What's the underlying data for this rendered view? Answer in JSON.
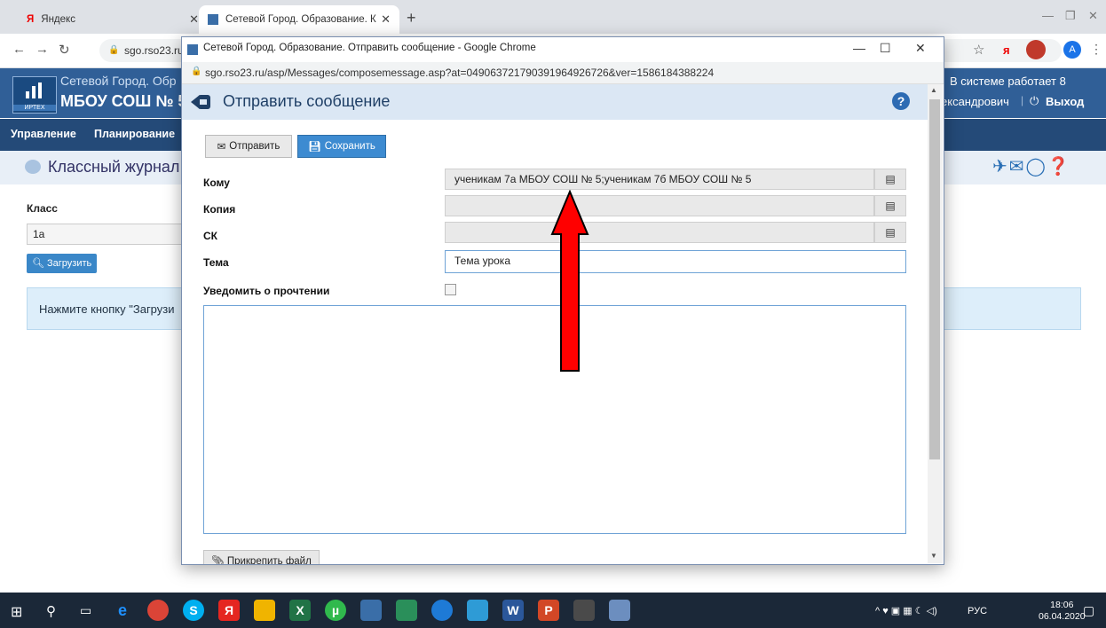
{
  "browser": {
    "tabs": [
      {
        "label": "Яндекс"
      },
      {
        "label": "Сетевой Город. Образование. К"
      }
    ],
    "url": "sgo.rso23.ru"
  },
  "site": {
    "name_line1": "Сетевой Город. Обр",
    "name_line2": "МБОУ СОШ № 5",
    "system_info": "В системе работает 8",
    "user_name": "ександрович",
    "exit_label": "Выход",
    "brand": "ИРТЕХ"
  },
  "menu": {
    "items": [
      "Управление",
      "Планирование"
    ]
  },
  "journal": {
    "title": "Классный журнал",
    "class_label": "Класс",
    "class_value": "1а",
    "load_label": "Загрузить",
    "notice": "Нажмите кнопку \"Загрузи"
  },
  "popup": {
    "window_title": "Сетевой Город. Образование. Отправить сообщение - Google Chrome",
    "url": "sgo.rso23.ru/asp/Messages/composemessage.asp?at=049063721790391964926726&ver=1586184388224",
    "heading": "Отправить сообщение",
    "send_label": "Отправить",
    "save_label": "Сохранить",
    "to_label": "Кому",
    "to_value": "ученикам 7а МБОУ СОШ № 5;ученикам 7б МБОУ СОШ № 5",
    "cc_label": "Копия",
    "cc_value": "",
    "bcc_label": "СК",
    "bcc_value": "",
    "subject_label": "Тема",
    "subject_value": "Тема урока",
    "read_receipt_label": "Уведомить о прочтении",
    "attach_label": "Прикрепить файл"
  },
  "taskbar": {
    "language": "РУС",
    "time": "18:06",
    "date": "06.04.2020"
  },
  "colors": {
    "site_header": "#305f97",
    "menu_bar": "#244a78",
    "accent_blue": "#3d8bd1",
    "arrow_red": "#ff0000"
  }
}
